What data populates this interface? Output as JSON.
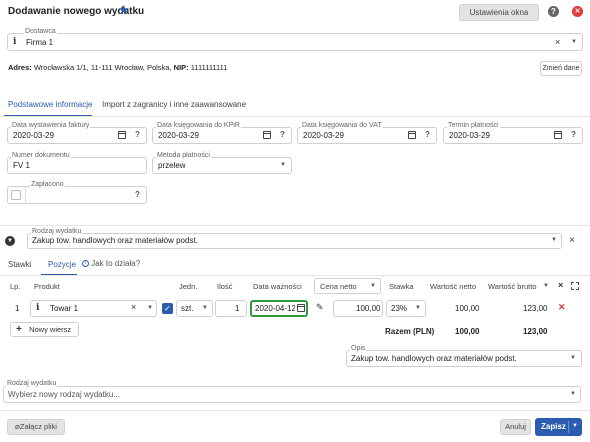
{
  "header": {
    "title": "Dodawanie nowego wydatku",
    "settings_label": "Ustawienia okna",
    "colors": {
      "star": "#2a5db0",
      "close": "#e03a3a",
      "primary": "#2a5db0",
      "active_tab": "#2a5db0",
      "focus_border": "#2e9b3e"
    }
  },
  "supplier": {
    "label": "Dostawca",
    "value": "Firma 1",
    "address_label": "Adres:",
    "address_value": "Wrocławska 1/1, 11-111 Wrocław, Polska,",
    "nip_label": "NIP:",
    "nip_value": "1111111111",
    "change_label": "Zmień dane"
  },
  "tabs": [
    {
      "label": "Podstawowe informacje"
    },
    {
      "label": "Import z zagranicy i inne zaawansowane"
    }
  ],
  "basic": {
    "issue_date_label": "Data wystawienia faktury",
    "issue_date": "2020-03-29",
    "kpir_date_label": "Data księgowania do KPiR",
    "kpir_date": "2020-03-29",
    "vat_date_label": "Data księgowania do VAT",
    "vat_date": "2020-03-29",
    "due_date_label": "Termin płatności",
    "due_date": "2020-03-29",
    "doc_number_label": "Numer dokumentu",
    "doc_number": "FV 1",
    "payment_method_label": "Metoda płatności",
    "payment_method": "przelew",
    "paid_label": "Zapłacono"
  },
  "expense_type": {
    "label": "Rodzaj wydatku",
    "value": "Zakup tow. handlowych oraz materiałów podst."
  },
  "subtabs": [
    {
      "label": "Stawki"
    },
    {
      "label": "Pozycje"
    },
    {
      "label": "Jak to działa?"
    }
  ],
  "table": {
    "headers": {
      "lp": "Lp.",
      "product": "Produkt",
      "unit": "Jedn.",
      "qty": "Ilość",
      "expiry": "Data ważności",
      "price_mode": "Cena netto",
      "rate": "Stawka",
      "net": "Wartość netto",
      "gross": "Wartość brutto"
    },
    "row": {
      "lp": "1",
      "product": "Towar 1",
      "unit": "szt.",
      "qty": "1",
      "expiry": "2020-04-12",
      "price": "100,00",
      "rate": "23%",
      "net": "100,00",
      "gross": "123,00"
    },
    "add_row_label": "Nowy wiersz",
    "total_label": "Razem (PLN)",
    "total_net": "100,00",
    "total_gross": "123,00"
  },
  "description": {
    "label": "Opis",
    "value": "Zakup tow. handlowych oraz materiałów podst."
  },
  "expense_type_bottom": {
    "label": "Rodzaj wydatku",
    "placeholder": "Wybierz nowy rodzaj wydatku..."
  },
  "footer": {
    "attach_label": "Załącz pliki",
    "cancel_label": "Anuluj",
    "save_label": "Zapisz"
  }
}
